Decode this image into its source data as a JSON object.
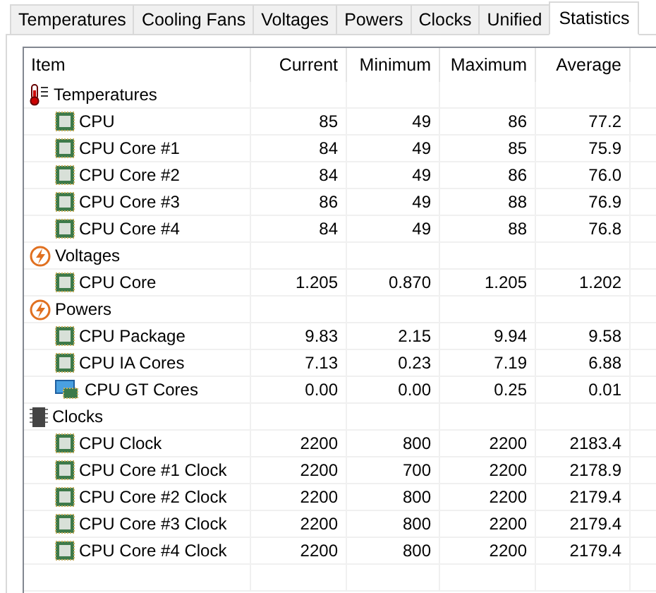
{
  "tabs": [
    {
      "label": "Temperatures",
      "selected": false
    },
    {
      "label": "Cooling Fans",
      "selected": false
    },
    {
      "label": "Voltages",
      "selected": false
    },
    {
      "label": "Powers",
      "selected": false
    },
    {
      "label": "Clocks",
      "selected": false
    },
    {
      "label": "Unified",
      "selected": false
    },
    {
      "label": "Statistics",
      "selected": true
    }
  ],
  "table": {
    "columns": [
      "Item",
      "Current",
      "Minimum",
      "Maximum",
      "Average"
    ],
    "groups": [
      {
        "label": "Temperatures",
        "kind": "temperature",
        "children": [
          {
            "label": "CPU",
            "kind": "chip",
            "values": [
              "85",
              "49",
              "86",
              "77.2"
            ]
          },
          {
            "label": "CPU Core #1",
            "kind": "chip",
            "values": [
              "84",
              "49",
              "85",
              "75.9"
            ]
          },
          {
            "label": "CPU Core #2",
            "kind": "chip",
            "values": [
              "84",
              "49",
              "86",
              "76.0"
            ]
          },
          {
            "label": "CPU Core #3",
            "kind": "chip",
            "values": [
              "86",
              "49",
              "88",
              "76.9"
            ]
          },
          {
            "label": "CPU Core #4",
            "kind": "chip",
            "values": [
              "84",
              "49",
              "88",
              "76.8"
            ]
          }
        ]
      },
      {
        "label": "Voltages",
        "kind": "voltage",
        "children": [
          {
            "label": "CPU Core",
            "kind": "chip",
            "values": [
              "1.205",
              "0.870",
              "1.205",
              "1.202"
            ]
          }
        ]
      },
      {
        "label": "Powers",
        "kind": "power",
        "children": [
          {
            "label": "CPU Package",
            "kind": "chip",
            "values": [
              "9.83",
              "2.15",
              "9.94",
              "9.58"
            ]
          },
          {
            "label": "CPU IA Cores",
            "kind": "chip",
            "values": [
              "7.13",
              "0.23",
              "7.19",
              "6.88"
            ]
          },
          {
            "label": "CPU GT Cores",
            "kind": "gpu",
            "values": [
              "0.00",
              "0.00",
              "0.25",
              "0.01"
            ]
          }
        ]
      },
      {
        "label": "Clocks",
        "kind": "clock",
        "children": [
          {
            "label": "CPU Clock",
            "kind": "chip",
            "values": [
              "2200",
              "800",
              "2200",
              "2183.4"
            ]
          },
          {
            "label": "CPU Core #1 Clock",
            "kind": "chip",
            "values": [
              "2200",
              "700",
              "2200",
              "2178.9"
            ]
          },
          {
            "label": "CPU Core #2 Clock",
            "kind": "chip",
            "values": [
              "2200",
              "800",
              "2200",
              "2179.4"
            ]
          },
          {
            "label": "CPU Core #3 Clock",
            "kind": "chip",
            "values": [
              "2200",
              "800",
              "2200",
              "2179.4"
            ]
          },
          {
            "label": "CPU Core #4 Clock",
            "kind": "chip",
            "values": [
              "2200",
              "800",
              "2200",
              "2179.4"
            ]
          }
        ]
      }
    ]
  }
}
